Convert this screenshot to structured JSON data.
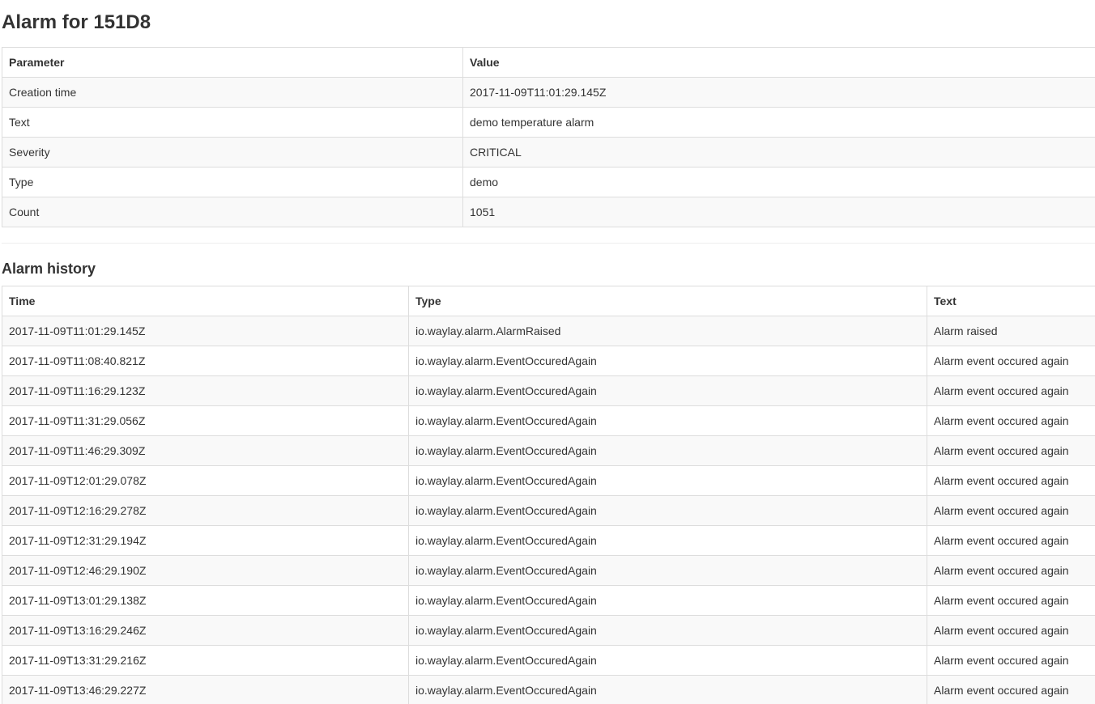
{
  "page": {
    "title": "Alarm for 151D8"
  },
  "params": {
    "headers": {
      "parameter": "Parameter",
      "value": "Value"
    },
    "rows": [
      {
        "name": "Creation time",
        "value": "2017-11-09T11:01:29.145Z"
      },
      {
        "name": "Text",
        "value": "demo temperature alarm"
      },
      {
        "name": "Severity",
        "value": "CRITICAL"
      },
      {
        "name": "Type",
        "value": "demo"
      },
      {
        "name": "Count",
        "value": "1051"
      }
    ]
  },
  "history": {
    "title": "Alarm history",
    "headers": {
      "time": "Time",
      "type": "Type",
      "text": "Text"
    },
    "rows": [
      {
        "time": "2017-11-09T11:01:29.145Z",
        "type": "io.waylay.alarm.AlarmRaised",
        "text": "Alarm raised"
      },
      {
        "time": "2017-11-09T11:08:40.821Z",
        "type": "io.waylay.alarm.EventOccuredAgain",
        "text": "Alarm event occured again"
      },
      {
        "time": "2017-11-09T11:16:29.123Z",
        "type": "io.waylay.alarm.EventOccuredAgain",
        "text": "Alarm event occured again"
      },
      {
        "time": "2017-11-09T11:31:29.056Z",
        "type": "io.waylay.alarm.EventOccuredAgain",
        "text": "Alarm event occured again"
      },
      {
        "time": "2017-11-09T11:46:29.309Z",
        "type": "io.waylay.alarm.EventOccuredAgain",
        "text": "Alarm event occured again"
      },
      {
        "time": "2017-11-09T12:01:29.078Z",
        "type": "io.waylay.alarm.EventOccuredAgain",
        "text": "Alarm event occured again"
      },
      {
        "time": "2017-11-09T12:16:29.278Z",
        "type": "io.waylay.alarm.EventOccuredAgain",
        "text": "Alarm event occured again"
      },
      {
        "time": "2017-11-09T12:31:29.194Z",
        "type": "io.waylay.alarm.EventOccuredAgain",
        "text": "Alarm event occured again"
      },
      {
        "time": "2017-11-09T12:46:29.190Z",
        "type": "io.waylay.alarm.EventOccuredAgain",
        "text": "Alarm event occured again"
      },
      {
        "time": "2017-11-09T13:01:29.138Z",
        "type": "io.waylay.alarm.EventOccuredAgain",
        "text": "Alarm event occured again"
      },
      {
        "time": "2017-11-09T13:16:29.246Z",
        "type": "io.waylay.alarm.EventOccuredAgain",
        "text": "Alarm event occured again"
      },
      {
        "time": "2017-11-09T13:31:29.216Z",
        "type": "io.waylay.alarm.EventOccuredAgain",
        "text": "Alarm event occured again"
      },
      {
        "time": "2017-11-09T13:46:29.227Z",
        "type": "io.waylay.alarm.EventOccuredAgain",
        "text": "Alarm event occured again"
      }
    ]
  }
}
